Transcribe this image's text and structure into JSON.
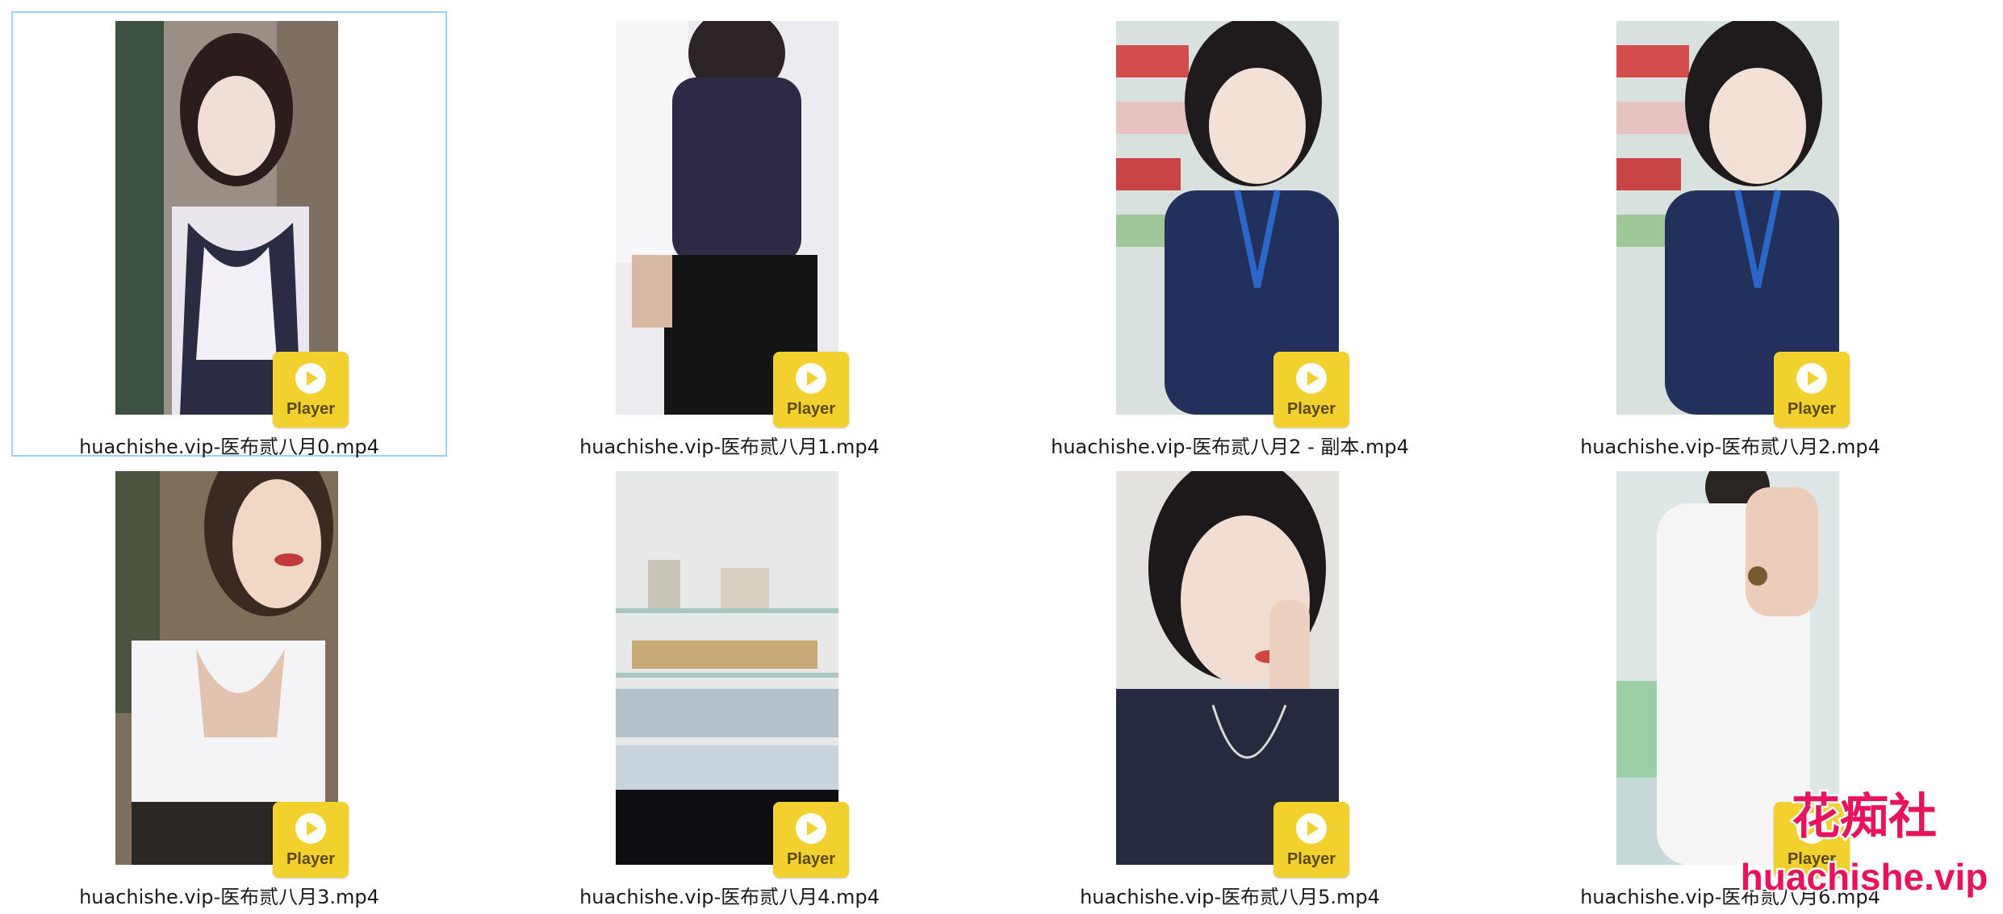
{
  "files": [
    {
      "name": "huachishe.vip-医布贰八月0.mp4",
      "selected": true
    },
    {
      "name": "huachishe.vip-医布贰八月1.mp4",
      "selected": false
    },
    {
      "name": "huachishe.vip-医布贰八月2 - 副本.mp4",
      "selected": false
    },
    {
      "name": "huachishe.vip-医布贰八月2.mp4",
      "selected": false
    },
    {
      "name": "huachishe.vip-医布贰八月3.mp4",
      "selected": false
    },
    {
      "name": "huachishe.vip-医布贰八月4.mp4",
      "selected": false
    },
    {
      "name": "huachishe.vip-医布贰八月5.mp4",
      "selected": false
    },
    {
      "name": "huachishe.vip-医布贰八月6.mp4",
      "selected": false
    }
  ],
  "badge": {
    "label": "Player",
    "icon": "play-icon",
    "color": "#f2d12e"
  },
  "watermark": {
    "title": "花痴社",
    "url": "huachishe.vip"
  },
  "colors": {
    "selection_border": "#99d1ff",
    "background": "#ffffff"
  }
}
